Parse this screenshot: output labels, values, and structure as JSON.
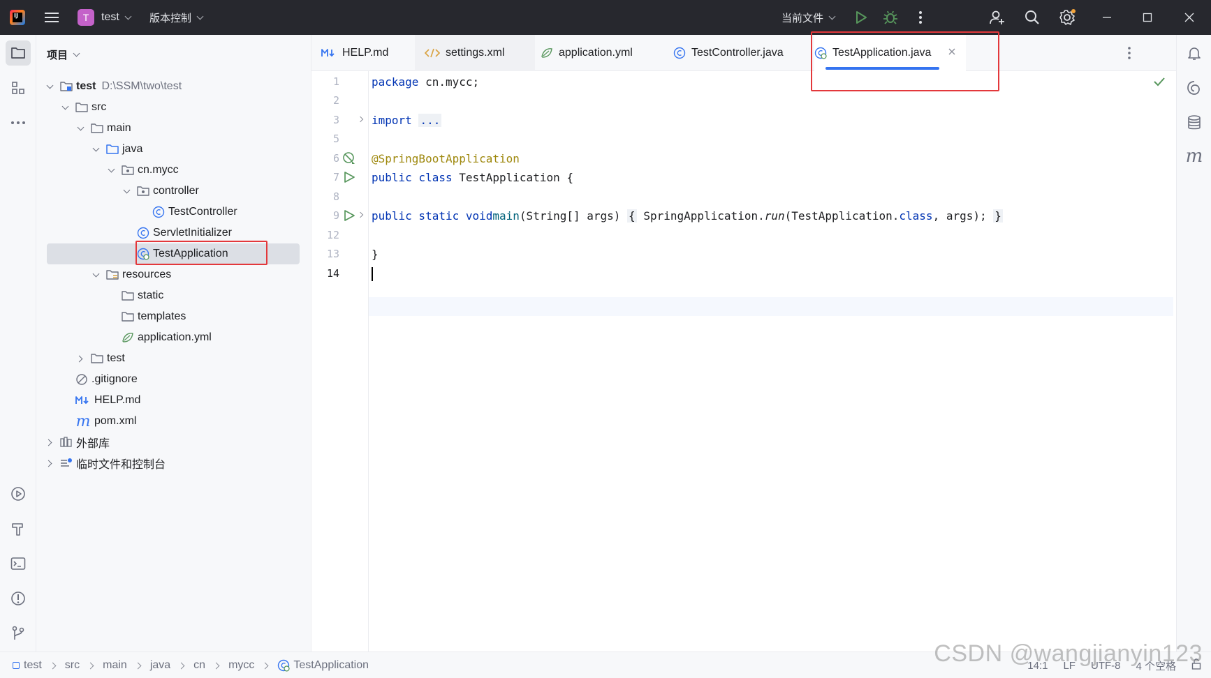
{
  "titlebar": {
    "project_badge": "T",
    "project_name": "test",
    "vcs_menu": "版本控制",
    "run_config": "当前文件"
  },
  "project_panel": {
    "title": "项目",
    "tree": [
      {
        "label": "test",
        "hint": "D:\\SSM\\two\\test",
        "icon": "module-folder-icon"
      },
      {
        "label": "src",
        "icon": "folder-icon"
      },
      {
        "label": "main",
        "icon": "folder-icon"
      },
      {
        "label": "java",
        "icon": "source-folder-icon"
      },
      {
        "label": "cn.mycc",
        "icon": "package-icon"
      },
      {
        "label": "controller",
        "icon": "package-icon"
      },
      {
        "label": "TestController",
        "icon": "class-icon"
      },
      {
        "label": "ServletInitializer",
        "icon": "class-icon"
      },
      {
        "label": "TestApplication",
        "icon": "spring-boot-class-icon"
      },
      {
        "label": "resources",
        "icon": "resources-folder-icon"
      },
      {
        "label": "static",
        "icon": "folder-icon"
      },
      {
        "label": "templates",
        "icon": "folder-icon"
      },
      {
        "label": "application.yml",
        "icon": "spring-yaml-icon"
      },
      {
        "label": "test",
        "icon": "folder-icon"
      },
      {
        "label": ".gitignore",
        "icon": "ignore-file-icon"
      },
      {
        "label": "HELP.md",
        "icon": "markdown-icon"
      },
      {
        "label": "pom.xml",
        "icon": "maven-icon"
      },
      {
        "label": "外部库",
        "icon": "library-icon"
      },
      {
        "label": "临时文件和控制台",
        "icon": "scratches-icon"
      }
    ]
  },
  "tabs": [
    {
      "label": "HELP.md",
      "icon": "markdown-icon"
    },
    {
      "label": "settings.xml",
      "icon": "xml-icon"
    },
    {
      "label": "application.yml",
      "icon": "spring-yaml-icon"
    },
    {
      "label": "TestController.java",
      "icon": "class-icon"
    },
    {
      "label": "TestApplication.java",
      "icon": "spring-boot-class-icon",
      "active": true
    }
  ],
  "editor": {
    "line_numbers": [
      "1",
      "2",
      "3",
      "5",
      "6",
      "7",
      "8",
      "9",
      "12",
      "13",
      "14"
    ],
    "code": {
      "l1_kw": "package",
      "l1_rest": " cn.mycc;",
      "l3_kw": "import",
      "l3_fold": "...",
      "l6_ann": "@SpringBootApplication",
      "l7_kw": "public class",
      "l7_rest": " TestApplication {",
      "l9_kw": "public static void",
      "l9_name": "main",
      "l9_args": "(String[] args) ",
      "l9_open": "{",
      "l9_cls": " SpringApplication.",
      "l9_run": "run",
      "l9_call": "(TestApplication.",
      "l9_class_kw": "class",
      "l9_end": ", args); ",
      "l9_close": "}",
      "l13": "}"
    }
  },
  "statusbar": {
    "breadcrumbs": [
      "test",
      "src",
      "main",
      "java",
      "cn",
      "mycc",
      "TestApplication"
    ],
    "position": "14:1",
    "line_sep": "LF",
    "encoding": "UTF-8",
    "indent": "4 个空格"
  },
  "watermark": "CSDN @wangjianyin123",
  "colors": {
    "accent": "#3574f0",
    "highlight_box": "#e3383b",
    "keyword": "#0033b3",
    "annotation": "#9e880d",
    "run_green": "#3a9b4b"
  }
}
